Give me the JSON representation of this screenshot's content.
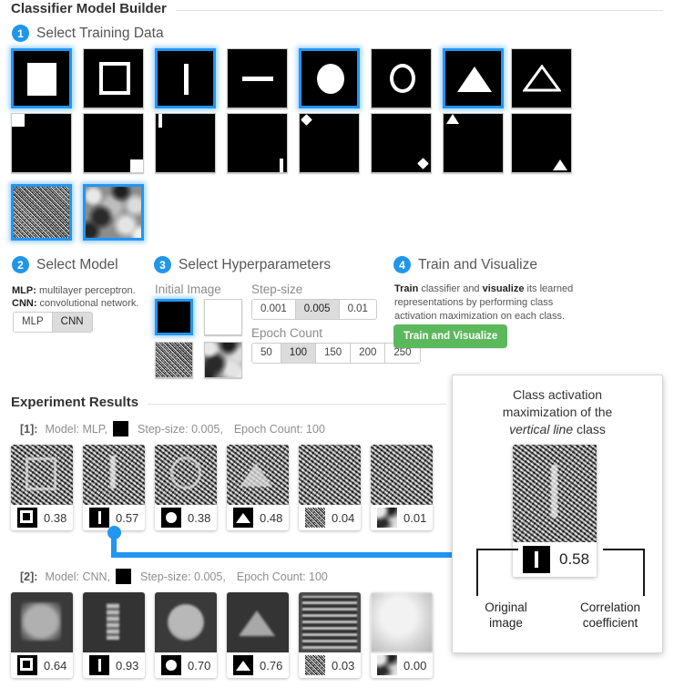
{
  "app": {
    "title": "Classifier Model Builder",
    "results_title": "Experiment Results"
  },
  "steps": {
    "one": {
      "number": "1",
      "label": "Select Training Data"
    },
    "two": {
      "number": "2",
      "label": "Select Model"
    },
    "three": {
      "number": "3",
      "label": "Select Hyperparameters"
    },
    "four": {
      "number": "4",
      "label": "Train and Visualize"
    }
  },
  "training_data": {
    "tiles": [
      {
        "name": "filled-square",
        "selected": true
      },
      {
        "name": "outline-square",
        "selected": false
      },
      {
        "name": "vertical-line",
        "selected": true
      },
      {
        "name": "horizontal-line",
        "selected": false
      },
      {
        "name": "filled-circle",
        "selected": true
      },
      {
        "name": "outline-circle",
        "selected": false
      },
      {
        "name": "filled-triangle",
        "selected": true
      },
      {
        "name": "outline-triangle",
        "selected": false
      },
      {
        "name": "small-square-top-left",
        "selected": false
      },
      {
        "name": "small-square-bottom-right",
        "selected": false
      },
      {
        "name": "small-vertical-line-top-left",
        "selected": false
      },
      {
        "name": "small-vertical-line-bottom-right",
        "selected": false
      },
      {
        "name": "small-circle-top-left",
        "selected": false
      },
      {
        "name": "small-circle-bottom-right",
        "selected": false
      },
      {
        "name": "small-triangle-top-left",
        "selected": false
      },
      {
        "name": "small-triangle-bottom-right",
        "selected": false
      },
      {
        "name": "fine-noise",
        "selected": true
      },
      {
        "name": "blurred-noise",
        "selected": true
      }
    ]
  },
  "model": {
    "note_mlp_term": "MLP:",
    "note_mlp_text": " multilayer perceptron.",
    "note_cnn_term": "CNN:",
    "note_cnn_text": " convolutional network.",
    "options": [
      {
        "label": "MLP",
        "selected": false
      },
      {
        "label": "CNN",
        "selected": true
      }
    ]
  },
  "hyperparameters": {
    "initial_image_label": "Initial Image",
    "initial_images": [
      {
        "name": "black",
        "selected": true
      },
      {
        "name": "white",
        "selected": false
      },
      {
        "name": "fine-noise",
        "selected": false
      },
      {
        "name": "blurred-noise",
        "selected": false
      }
    ],
    "step_size_label": "Step-size",
    "step_size_options": [
      {
        "label": "0.001",
        "selected": false
      },
      {
        "label": "0.005",
        "selected": true
      },
      {
        "label": "0.01",
        "selected": false
      }
    ],
    "epoch_label": "Epoch Count",
    "epoch_options": [
      {
        "label": "50",
        "selected": false
      },
      {
        "label": "100",
        "selected": true
      },
      {
        "label": "150",
        "selected": false
      },
      {
        "label": "200",
        "selected": false
      },
      {
        "label": "250",
        "selected": false
      }
    ]
  },
  "train": {
    "desc_1": "Train",
    "desc_2": " classifier and ",
    "desc_3": "visualize",
    "desc_4": " its learned representations by performing class activation maximization on each class.",
    "button_label": "Train and Visualize",
    "button_color": "#5cb85c"
  },
  "experiments": [
    {
      "index": "[1]:",
      "model_text": "Model: MLP,",
      "step_text": "Step-size: 0.005,",
      "epoch_text": "Epoch Count: 100",
      "results": [
        {
          "class": "square",
          "value": "0.38"
        },
        {
          "class": "vertical-line",
          "value": "0.57"
        },
        {
          "class": "circle",
          "value": "0.38"
        },
        {
          "class": "triangle",
          "value": "0.48"
        },
        {
          "class": "fine-noise",
          "value": "0.04"
        },
        {
          "class": "blurred-noise",
          "value": "0.01"
        }
      ]
    },
    {
      "index": "[2]:",
      "model_text": "Model: CNN,",
      "step_text": "Step-size: 0.005,",
      "epoch_text": "Epoch Count: 100",
      "results": [
        {
          "class": "square",
          "value": "0.64"
        },
        {
          "class": "vertical-line",
          "value": "0.93"
        },
        {
          "class": "circle",
          "value": "0.70"
        },
        {
          "class": "triangle",
          "value": "0.76"
        },
        {
          "class": "fine-noise",
          "value": "0.03"
        },
        {
          "class": "blurred-noise",
          "value": "0.00"
        }
      ]
    }
  ],
  "callout": {
    "title_line1": "Class activation",
    "title_line2": "maximization of the",
    "title_emphasis": "vertical line",
    "title_suffix": " class",
    "value": "0.58",
    "anno_left_line1": "Original",
    "anno_left_line2": "image",
    "anno_right_line1": "Correlation",
    "anno_right_line2": "coefficient",
    "accent_color": "#2196f3"
  }
}
